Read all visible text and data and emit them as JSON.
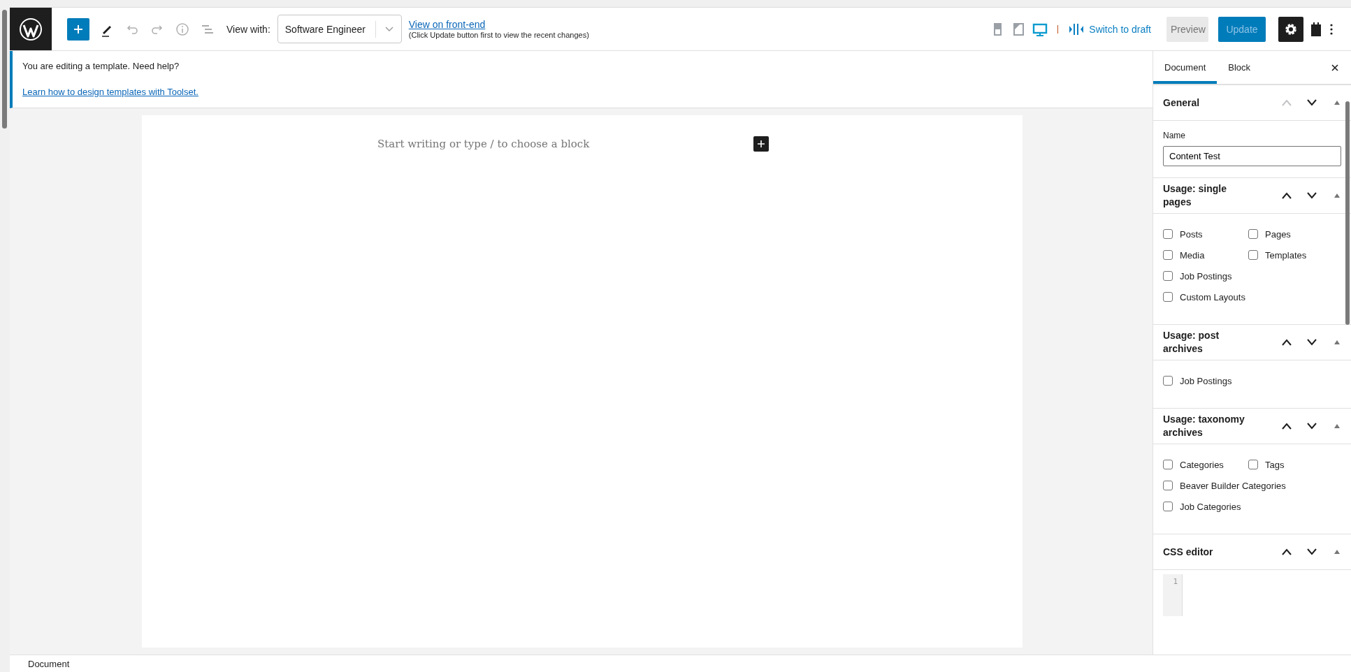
{
  "toolbar": {
    "view_with_label": "View with:",
    "view_with_value": "Software Engineer",
    "front_end_link": "View on front-end",
    "front_end_note": "(Click Update button first to view the recent changes)",
    "devices": [
      {
        "kind": "mobile",
        "selected": false
      },
      {
        "kind": "tablet",
        "selected": false
      },
      {
        "kind": "desktop",
        "selected": true
      }
    ],
    "switch_to_draft": "Switch to draft",
    "preview": "Preview",
    "update": "Update",
    "settings_selected": true
  },
  "notice": {
    "text": "You are editing a template. Need help?",
    "link": "Learn how to design templates with Toolset."
  },
  "editor": {
    "placeholder": "Start writing or type / to choose a block"
  },
  "sidebar": {
    "tabs": [
      {
        "label": "Document",
        "selected": true
      },
      {
        "label": "Block",
        "selected": false
      }
    ],
    "panels": [
      {
        "title": "General",
        "kind": "field",
        "up_disabled": true,
        "label": "Name",
        "value": "Content Test"
      },
      {
        "title": "Usage: single pages",
        "kind": "checkboxes",
        "up_disabled": false,
        "rows": [
          [
            {
              "label": "Posts",
              "checked": false
            },
            {
              "label": "Pages",
              "checked": false
            }
          ],
          [
            {
              "label": "Media",
              "checked": false
            },
            {
              "label": "Templates",
              "checked": false
            }
          ],
          [
            {
              "label": "Job Postings",
              "checked": false
            }
          ],
          [
            {
              "label": "Custom Layouts",
              "checked": false
            }
          ]
        ]
      },
      {
        "title": "Usage: post archives",
        "kind": "checkboxes",
        "up_disabled": false,
        "rows": [
          [
            {
              "label": "Job Postings",
              "checked": false
            }
          ]
        ]
      },
      {
        "title": "Usage: taxonomy archives",
        "kind": "checkboxes",
        "up_disabled": false,
        "rows": [
          [
            {
              "label": "Categories",
              "checked": false
            },
            {
              "label": "Tags",
              "checked": false
            }
          ],
          [
            {
              "label": "Beaver Builder Categories",
              "checked": false
            }
          ],
          [
            {
              "label": "Job Categories",
              "checked": false
            }
          ]
        ]
      },
      {
        "title": "CSS editor",
        "kind": "code",
        "up_disabled": false,
        "line_numbers": [
          "1"
        ]
      }
    ]
  },
  "footer": {
    "breadcrumb": "Document"
  }
}
